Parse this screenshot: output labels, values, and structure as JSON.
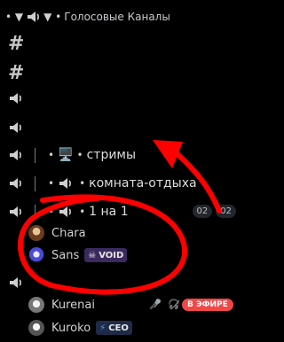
{
  "header": {
    "title": "Голосовые Каналы",
    "prefix": "• ▼",
    "icon": "speaker"
  },
  "channels": [
    {
      "type": "text",
      "icon": "hash"
    },
    {
      "type": "text",
      "icon": "hash"
    },
    {
      "type": "voice",
      "icon": "speaker"
    },
    {
      "type": "voice",
      "icon": "speaker"
    },
    {
      "type": "voice",
      "icon": "speaker",
      "emoji": "🖥️",
      "name": "стримы"
    },
    {
      "type": "voice",
      "icon": "speaker",
      "name": "комната-отдыха"
    },
    {
      "type": "voice",
      "icon": "speaker",
      "name": "1 на 1",
      "counts": [
        "02",
        "02"
      ]
    }
  ],
  "users_1na1": [
    {
      "name": "Chara",
      "avatar": "chara-avatar"
    },
    {
      "name": "Sans",
      "avatar": "sans-avatar",
      "badge": "VOID",
      "badge_icon": "skull"
    }
  ],
  "bottom_channel": {
    "users": [
      {
        "name": "Kurenai",
        "avatar": "kurenai-avatar",
        "live_label": "В ЭФИРЕ"
      },
      {
        "name": "Kuroko",
        "avatar": "kuroko-avatar",
        "badge": "CEO",
        "badge_icon": "lightning"
      }
    ]
  },
  "annotations": {
    "circle_color": "#ff0000",
    "arrow_color": "#ff0000"
  }
}
